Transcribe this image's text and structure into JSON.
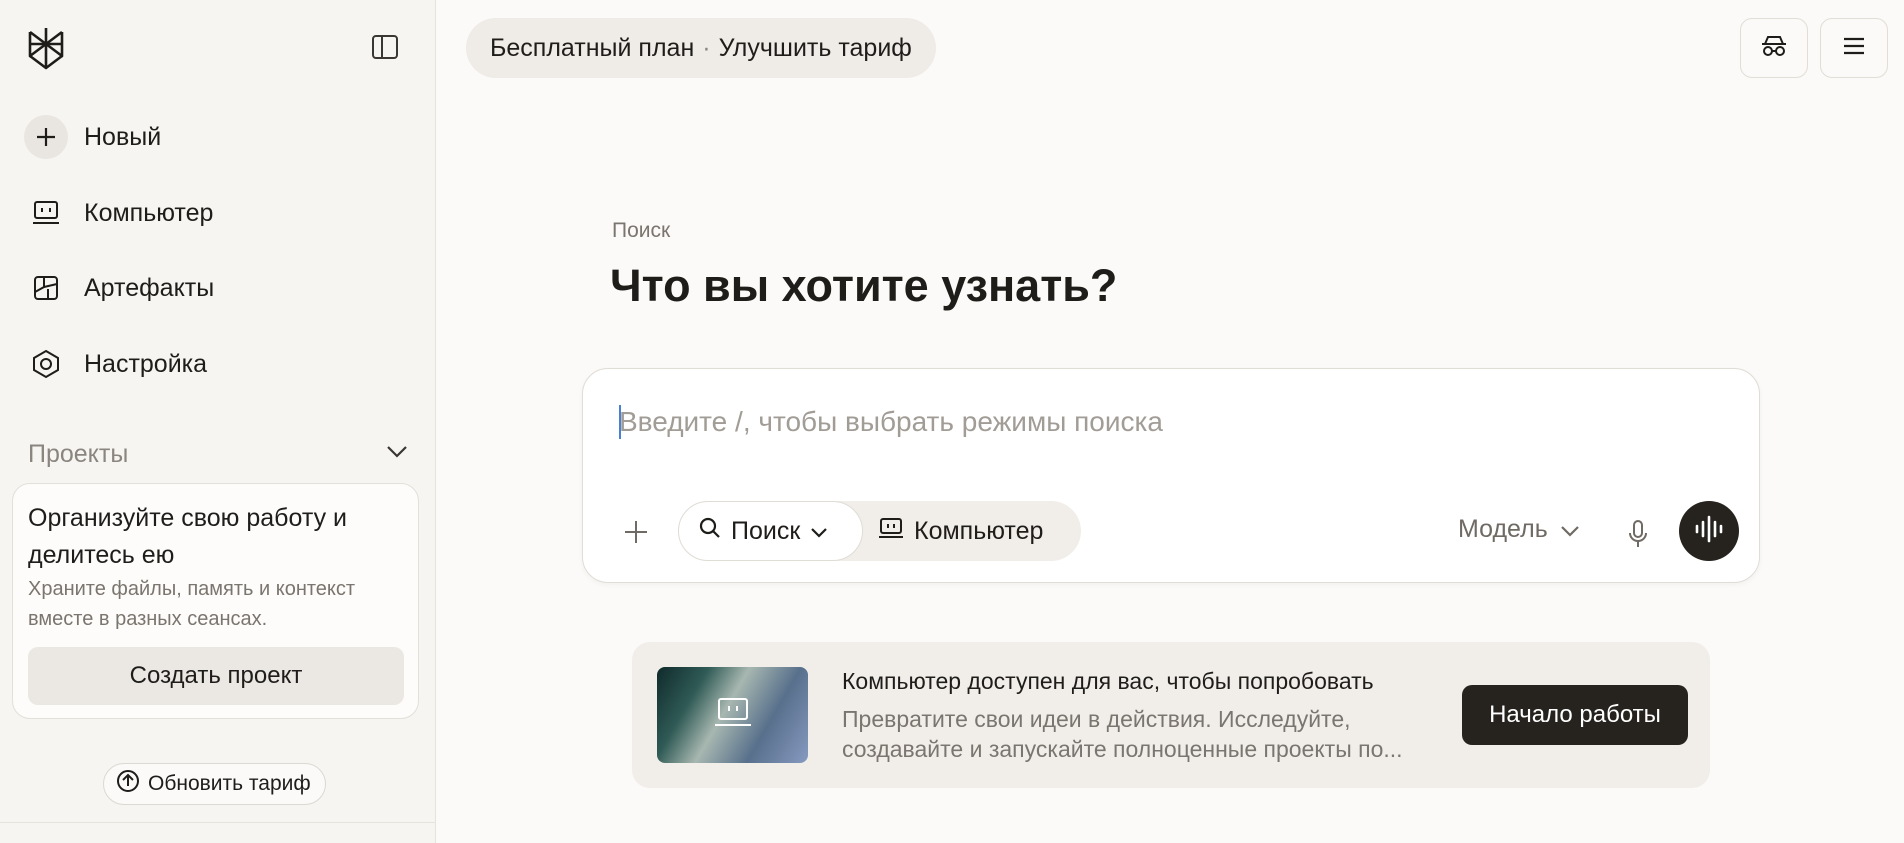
{
  "sidebar": {
    "logo_icon": "perplexity-logo-icon",
    "collapse_icon": "sidebar-toggle-icon",
    "items": [
      {
        "label": "Новый",
        "icon": "plus-icon"
      },
      {
        "label": "Компьютер",
        "icon": "laptop-icon"
      },
      {
        "label": "Артефакты",
        "icon": "artifacts-icon"
      },
      {
        "label": "Настройка",
        "icon": "hexagon-settings-icon"
      }
    ],
    "projects": {
      "label": "Проекты",
      "card_title": "Организуйте свою работу и делитесь ею",
      "card_desc": "Храните файлы, память и контекст вместе в разных сеансах.",
      "card_button": "Создать проект"
    },
    "upgrade_button": "Обновить тариф"
  },
  "topbar": {
    "plan_label": "Бесплатный план",
    "plan_separator": "·",
    "upgrade_link": "Улучшить тариф",
    "incognito_icon": "incognito-icon",
    "menu_icon": "menu-icon"
  },
  "main": {
    "eyebrow": "Поиск",
    "headline": "Что вы хотите узнать?",
    "composer": {
      "placeholder": "Введите /, чтобы выбрать режимы поиска",
      "value": "",
      "mode_search": "Поиск",
      "mode_computer": "Компьютер",
      "model_label": "Модель"
    },
    "promo": {
      "title": "Компьютер доступен для вас, чтобы попробовать",
      "desc": "Превратите свои идеи в действия. Исследуйте, создавайте и запускайте полноценные проекты по...",
      "button": "Начало работы"
    }
  },
  "colors": {
    "background": "#fbfaf8",
    "sidebar": "#f7f5f2",
    "accent_dark": "#26231f",
    "muted_text": "#7a756e"
  }
}
